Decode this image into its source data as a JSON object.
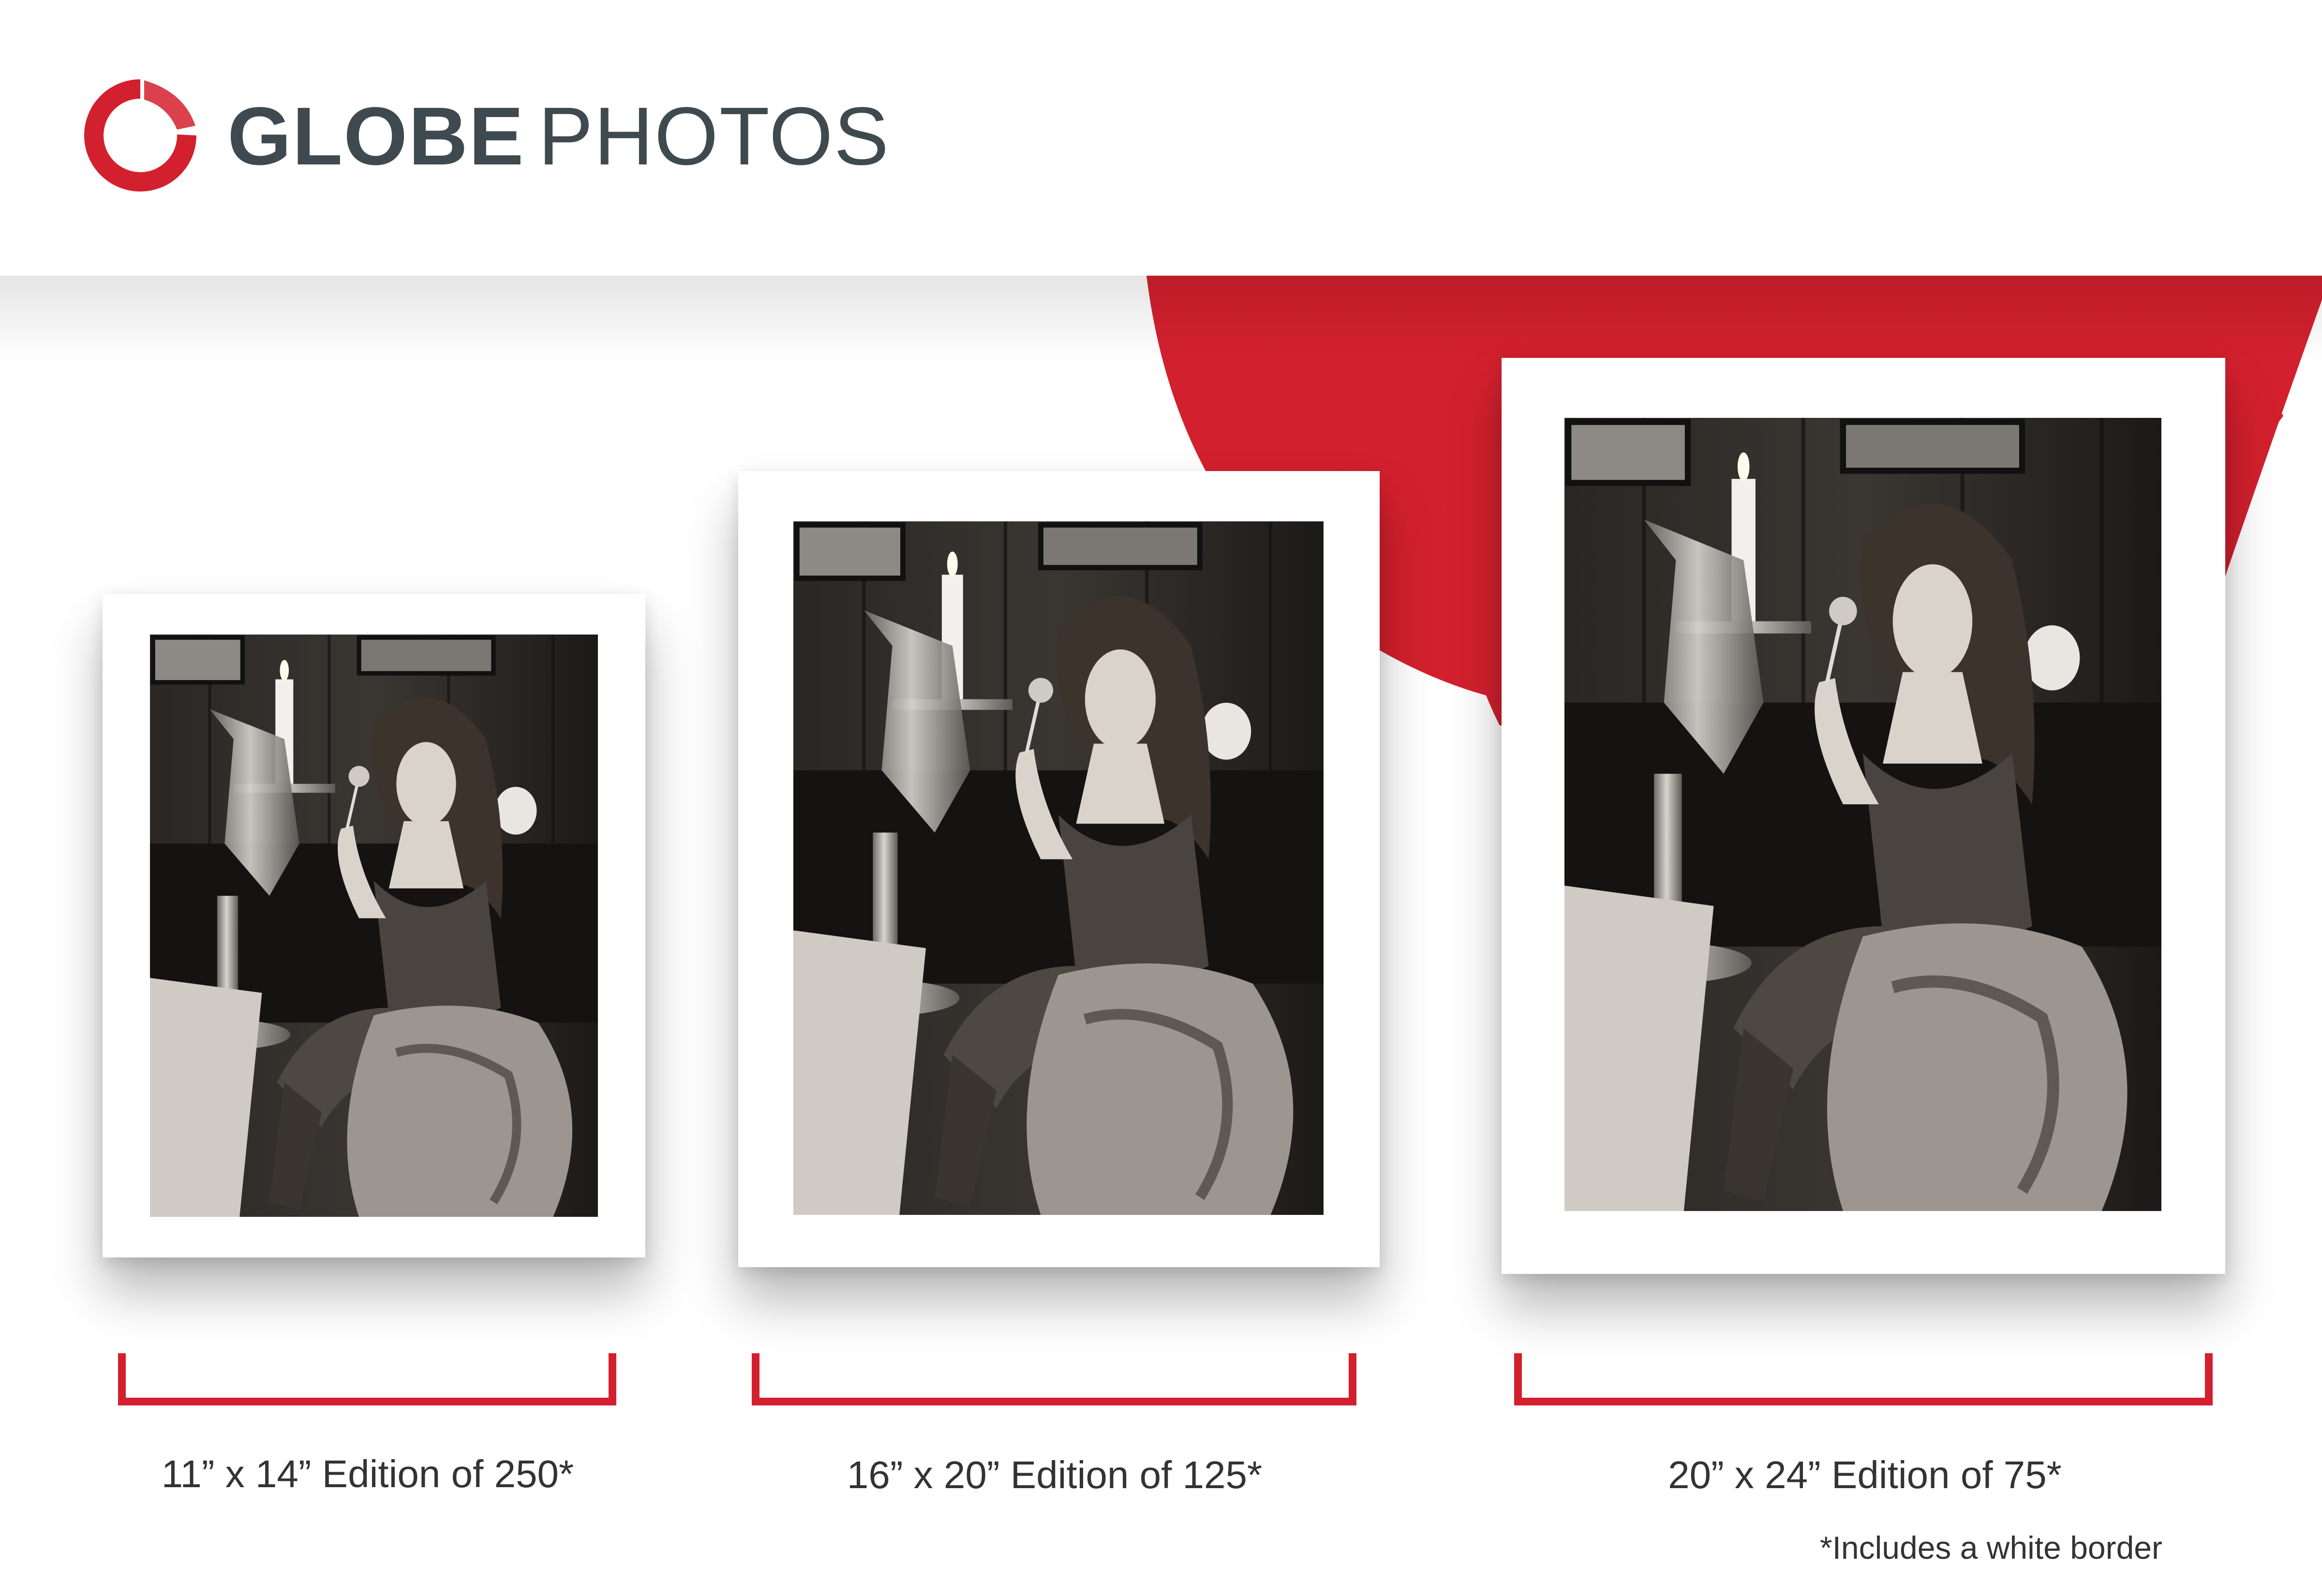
{
  "brand": {
    "name_bold": "GLOBE",
    "name_light": "PHOTOS",
    "text_color": "#3e4a4f",
    "accent_color": "#d3202e"
  },
  "prints": [
    {
      "id": "small",
      "caption": "11” x 14” Edition of 250*",
      "size_label": "11” x 14”",
      "edition": 250
    },
    {
      "id": "medium",
      "caption": "16” x 20” Edition of 125*",
      "size_label": "16” x 20”",
      "edition": 125
    },
    {
      "id": "large",
      "caption": "20” x 24” Edition of 75*",
      "size_label": "20” x 24”",
      "edition": 75
    }
  ],
  "footnote": "*Includes a white border",
  "colors": {
    "accent": "#d3202e",
    "text": "#333333",
    "background": "#ffffff",
    "photo_dark": "#1e1c1a"
  }
}
